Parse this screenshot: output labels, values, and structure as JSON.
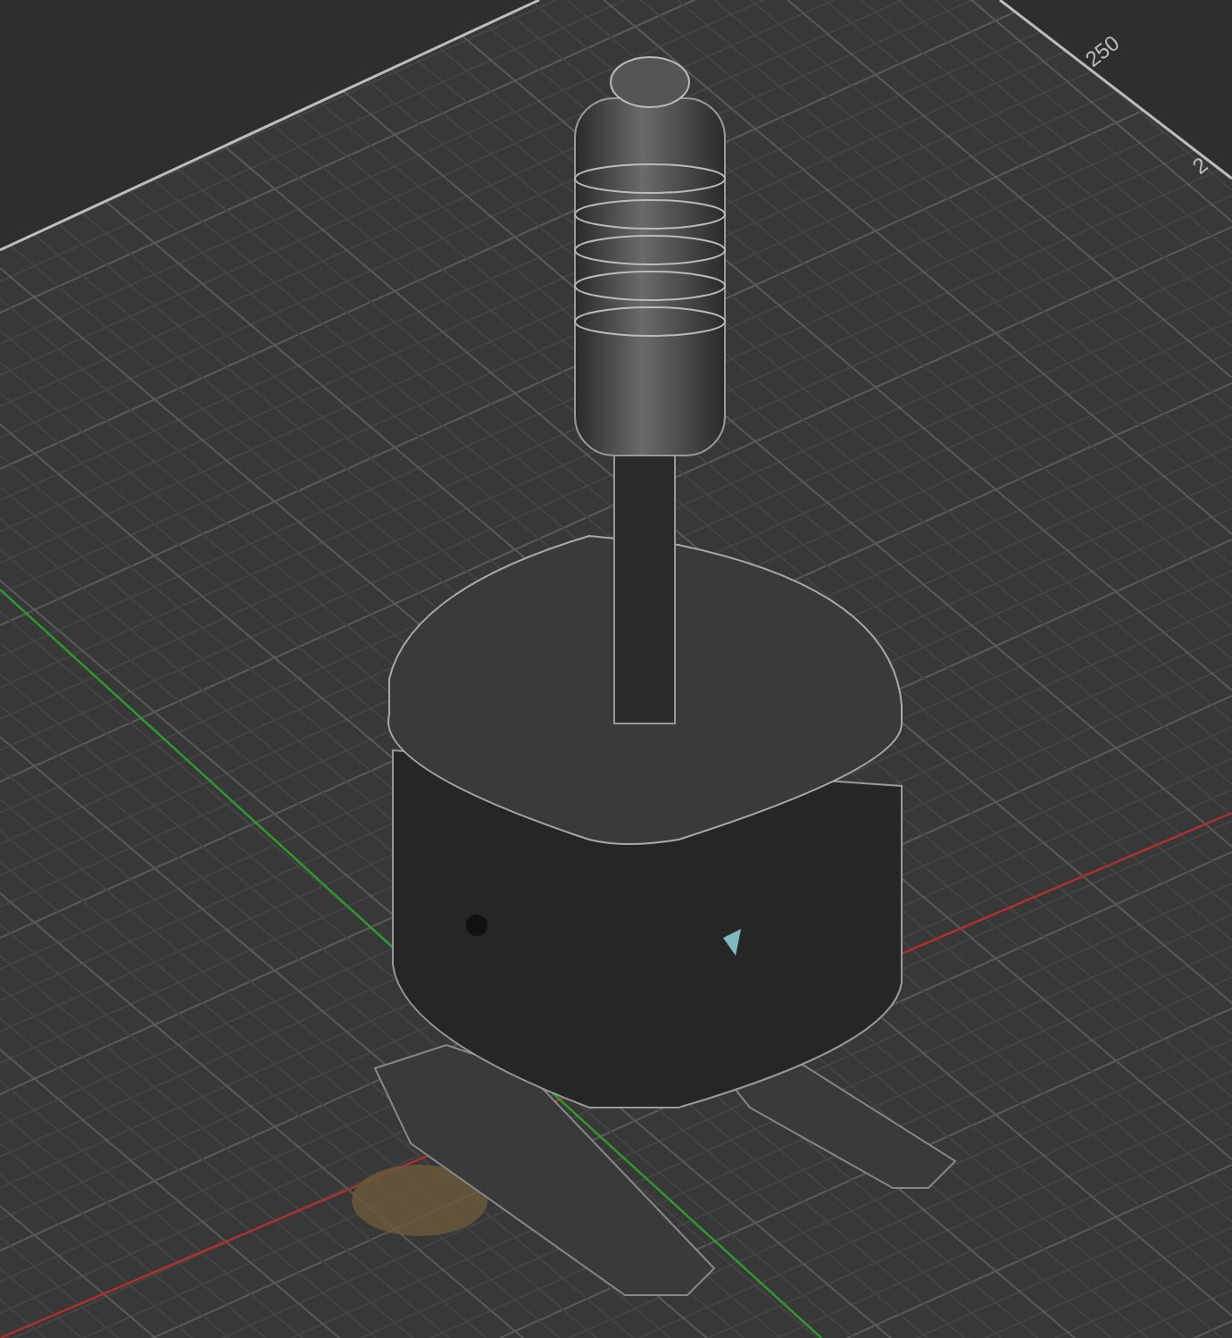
{
  "viewport": {
    "grid_labels": [
      "250",
      "2"
    ]
  }
}
